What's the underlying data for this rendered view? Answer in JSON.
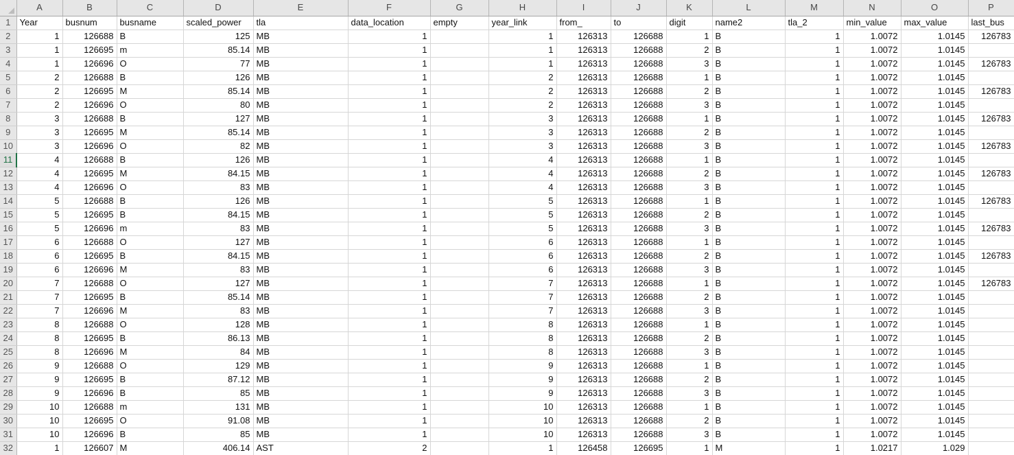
{
  "app": "spreadsheet-grid",
  "colors": {
    "header_bg": "#e6e6e6",
    "gridline": "#d6d6d6",
    "selection_green": "#217346"
  },
  "selection": {
    "active_row": 11
  },
  "column_letters": [
    "A",
    "B",
    "C",
    "D",
    "E",
    "F",
    "G",
    "H",
    "I",
    "J",
    "K",
    "L",
    "M",
    "N",
    "O",
    "P"
  ],
  "header_row": [
    "Year",
    "busnum",
    "busname",
    "scaled_power",
    "tla",
    "data_location",
    "empty",
    "year_link",
    "from_",
    "to",
    "digit",
    "name2",
    "tla_2",
    "min_value",
    "max_value",
    "last_bus"
  ],
  "data_rows": [
    [
      1,
      126688,
      "B",
      125,
      "MB",
      1,
      "",
      1,
      126313,
      126688,
      1,
      "B",
      1,
      1.0072,
      1.0145,
      126783
    ],
    [
      1,
      126695,
      "m",
      85.14,
      "MB",
      1,
      "",
      1,
      126313,
      126688,
      2,
      "B",
      1,
      1.0072,
      1.0145,
      ""
    ],
    [
      1,
      126696,
      "O",
      77,
      "MB",
      1,
      "",
      1,
      126313,
      126688,
      3,
      "B",
      1,
      1.0072,
      1.0145,
      126783
    ],
    [
      2,
      126688,
      "B",
      126,
      "MB",
      1,
      "",
      2,
      126313,
      126688,
      1,
      "B",
      1,
      1.0072,
      1.0145,
      ""
    ],
    [
      2,
      126695,
      "M",
      85.14,
      "MB",
      1,
      "",
      2,
      126313,
      126688,
      2,
      "B",
      1,
      1.0072,
      1.0145,
      126783
    ],
    [
      2,
      126696,
      "O",
      80,
      "MB",
      1,
      "",
      2,
      126313,
      126688,
      3,
      "B",
      1,
      1.0072,
      1.0145,
      ""
    ],
    [
      3,
      126688,
      "B",
      127,
      "MB",
      1,
      "",
      3,
      126313,
      126688,
      1,
      "B",
      1,
      1.0072,
      1.0145,
      126783
    ],
    [
      3,
      126695,
      "M",
      85.14,
      "MB",
      1,
      "",
      3,
      126313,
      126688,
      2,
      "B",
      1,
      1.0072,
      1.0145,
      ""
    ],
    [
      3,
      126696,
      "O",
      82,
      "MB",
      1,
      "",
      3,
      126313,
      126688,
      3,
      "B",
      1,
      1.0072,
      1.0145,
      126783
    ],
    [
      4,
      126688,
      "B",
      126,
      "MB",
      1,
      "",
      4,
      126313,
      126688,
      1,
      "B",
      1,
      1.0072,
      1.0145,
      ""
    ],
    [
      4,
      126695,
      "M",
      84.15,
      "MB",
      1,
      "",
      4,
      126313,
      126688,
      2,
      "B",
      1,
      1.0072,
      1.0145,
      126783
    ],
    [
      4,
      126696,
      "O",
      83,
      "MB",
      1,
      "",
      4,
      126313,
      126688,
      3,
      "B",
      1,
      1.0072,
      1.0145,
      ""
    ],
    [
      5,
      126688,
      "B",
      126,
      "MB",
      1,
      "",
      5,
      126313,
      126688,
      1,
      "B",
      1,
      1.0072,
      1.0145,
      126783
    ],
    [
      5,
      126695,
      "B",
      84.15,
      "MB",
      1,
      "",
      5,
      126313,
      126688,
      2,
      "B",
      1,
      1.0072,
      1.0145,
      ""
    ],
    [
      5,
      126696,
      "m",
      83,
      "MB",
      1,
      "",
      5,
      126313,
      126688,
      3,
      "B",
      1,
      1.0072,
      1.0145,
      126783
    ],
    [
      6,
      126688,
      "O",
      127,
      "MB",
      1,
      "",
      6,
      126313,
      126688,
      1,
      "B",
      1,
      1.0072,
      1.0145,
      ""
    ],
    [
      6,
      126695,
      "B",
      84.15,
      "MB",
      1,
      "",
      6,
      126313,
      126688,
      2,
      "B",
      1,
      1.0072,
      1.0145,
      126783
    ],
    [
      6,
      126696,
      "M",
      83,
      "MB",
      1,
      "",
      6,
      126313,
      126688,
      3,
      "B",
      1,
      1.0072,
      1.0145,
      ""
    ],
    [
      7,
      126688,
      "O",
      127,
      "MB",
      1,
      "",
      7,
      126313,
      126688,
      1,
      "B",
      1,
      1.0072,
      1.0145,
      126783
    ],
    [
      7,
      126695,
      "B",
      85.14,
      "MB",
      1,
      "",
      7,
      126313,
      126688,
      2,
      "B",
      1,
      1.0072,
      1.0145,
      ""
    ],
    [
      7,
      126696,
      "M",
      83,
      "MB",
      1,
      "",
      7,
      126313,
      126688,
      3,
      "B",
      1,
      1.0072,
      1.0145,
      ""
    ],
    [
      8,
      126688,
      "O",
      128,
      "MB",
      1,
      "",
      8,
      126313,
      126688,
      1,
      "B",
      1,
      1.0072,
      1.0145,
      ""
    ],
    [
      8,
      126695,
      "B",
      86.13,
      "MB",
      1,
      "",
      8,
      126313,
      126688,
      2,
      "B",
      1,
      1.0072,
      1.0145,
      ""
    ],
    [
      8,
      126696,
      "M",
      84,
      "MB",
      1,
      "",
      8,
      126313,
      126688,
      3,
      "B",
      1,
      1.0072,
      1.0145,
      ""
    ],
    [
      9,
      126688,
      "O",
      129,
      "MB",
      1,
      "",
      9,
      126313,
      126688,
      1,
      "B",
      1,
      1.0072,
      1.0145,
      ""
    ],
    [
      9,
      126695,
      "B",
      87.12,
      "MB",
      1,
      "",
      9,
      126313,
      126688,
      2,
      "B",
      1,
      1.0072,
      1.0145,
      ""
    ],
    [
      9,
      126696,
      "B",
      85,
      "MB",
      1,
      "",
      9,
      126313,
      126688,
      3,
      "B",
      1,
      1.0072,
      1.0145,
      ""
    ],
    [
      10,
      126688,
      "m",
      131,
      "MB",
      1,
      "",
      10,
      126313,
      126688,
      1,
      "B",
      1,
      1.0072,
      1.0145,
      ""
    ],
    [
      10,
      126695,
      "O",
      91.08,
      "MB",
      1,
      "",
      10,
      126313,
      126688,
      2,
      "B",
      1,
      1.0072,
      1.0145,
      ""
    ],
    [
      10,
      126696,
      "B",
      85,
      "MB",
      1,
      "",
      10,
      126313,
      126688,
      3,
      "B",
      1,
      1.0072,
      1.0145,
      ""
    ],
    [
      1,
      126607,
      "M",
      406.14,
      "AST",
      2,
      "",
      1,
      126458,
      126695,
      1,
      "M",
      1,
      1.0217,
      1.029,
      ""
    ]
  ]
}
